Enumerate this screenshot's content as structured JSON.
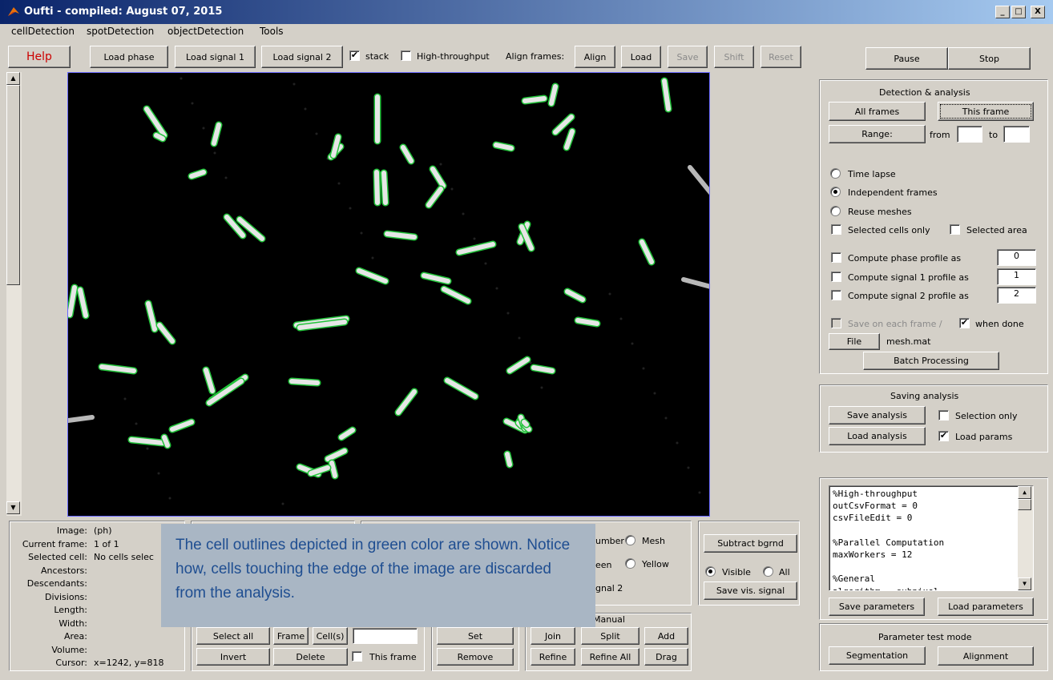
{
  "window": {
    "title": "Oufti - compiled: August 07, 2015",
    "min": "_",
    "max": "□",
    "close": "X"
  },
  "menus": [
    "cellDetection",
    "spotDetection",
    "objectDetection",
    "Tools"
  ],
  "toolbar": {
    "help": "Help",
    "load_phase": "Load phase",
    "load_signal1": "Load signal 1",
    "load_signal2": "Load signal 2",
    "stack": "stack",
    "stack_checked": "✔",
    "high_throughput": "High-throughput",
    "align_frames": "Align frames:",
    "align": "Align",
    "load": "Load",
    "save": "Save",
    "shift": "Shift",
    "reset": "Reset",
    "pause": "Pause",
    "stop": "Stop"
  },
  "detection": {
    "title": "Detection & analysis",
    "all_frames": "All frames",
    "this_frame": "This frame",
    "range": "Range:",
    "from": "from",
    "to": "to",
    "time_lapse": "Time lapse",
    "independent_frames": "Independent frames",
    "reuse_meshes": "Reuse meshes",
    "selected_cells_only": "Selected cells only",
    "selected_area": "Selected area",
    "compute_phase": "Compute phase profile as",
    "compute_phase_val": "0",
    "compute_sig1": "Compute signal 1 profile as",
    "compute_sig1_val": "1",
    "compute_sig2": "Compute signal 2 profile as",
    "compute_sig2_val": "2",
    "save_each_frame": "Save on each frame /",
    "when_done": "when done",
    "when_done_checked": "✔",
    "file": "File",
    "mesh_file": "mesh.mat",
    "batch": "Batch Processing"
  },
  "saving": {
    "title": "Saving analysis",
    "save_analysis": "Save analysis",
    "selection_only": "Selection only",
    "load_analysis": "Load analysis",
    "load_params": "Load params",
    "load_params_checked": "✔"
  },
  "params": {
    "lines": [
      "%High-throughput",
      "outCsvFormat = 0",
      "csvFileEdit = 0",
      "",
      "%Parallel Computation",
      "maxWorkers = 12",
      "",
      "%General",
      "algorithm = subpixel"
    ],
    "save_parameters": "Save parameters",
    "load_parameters": "Load parameters",
    "test_mode": "Parameter test mode",
    "segmentation": "Segmentation",
    "alignment": "Alignment"
  },
  "info": {
    "labels": [
      "Image:",
      "Current frame:",
      "Selected cell:",
      "Ancestors:",
      "Descendants:",
      "Divisions:",
      "Length:",
      "Width:",
      "Area:",
      "Volume:",
      "Cursor:"
    ],
    "values": [
      "(ph)",
      "1 of 1",
      "No cells selec",
      "",
      "",
      "",
      "",
      "",
      "",
      "",
      "x=1242, y=818"
    ]
  },
  "display": {
    "number": "umber",
    "mesh": "Mesh",
    "green": "een",
    "yellow": "Yellow",
    "signal2": "gnal 2",
    "subtract_bgnd": "Subtract bgrnd",
    "visible": "Visible",
    "all": "All",
    "save_vis_signal": "Save vis. signal"
  },
  "selection": {
    "select_all": "Select all",
    "frame": "Frame",
    "cells": "Cell(s)",
    "invert": "Invert",
    "delete": "Delete",
    "this_frame": "This frame",
    "set": "Set",
    "remove": "Remove"
  },
  "manual": {
    "title": "Manual",
    "join": "Join",
    "split": "Split",
    "add": "Add",
    "refine": "Refine",
    "refine_all": "Refine All",
    "drag": "Drag"
  },
  "overlay": {
    "text": "The cell outlines depicted in green color are shown.  Notice how, cells touching the edge of the image are discarded from the analysis."
  },
  "colors": {
    "outline": "#22c33a",
    "overlay_text": "#1f4e91",
    "help_text": "#cc0000"
  }
}
